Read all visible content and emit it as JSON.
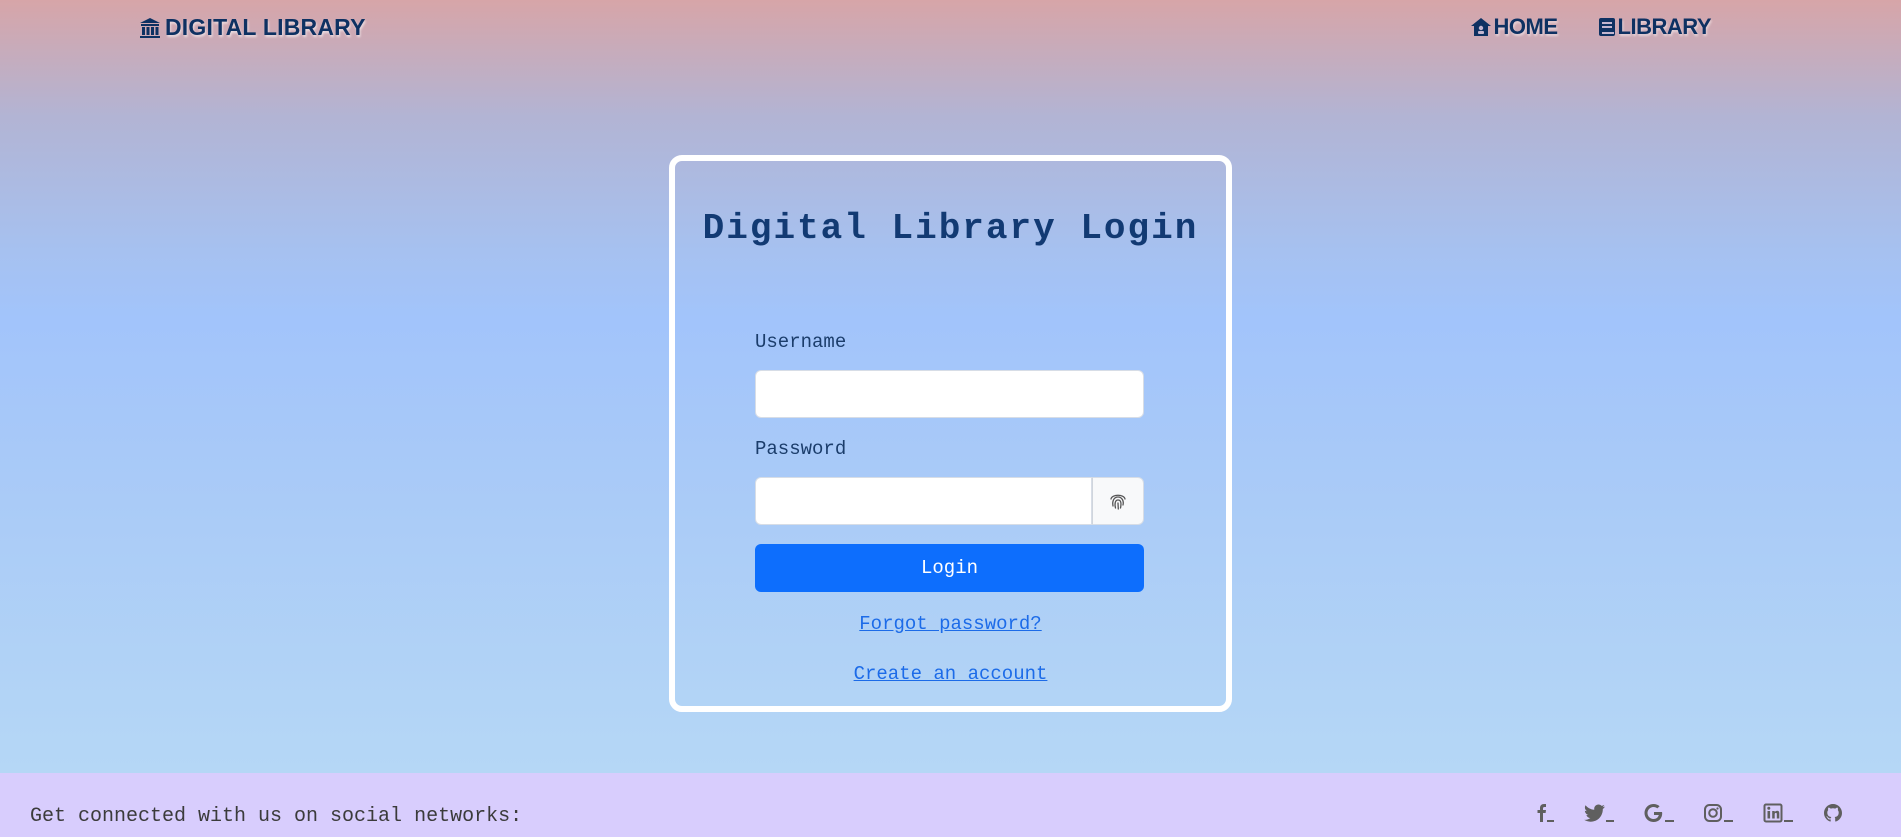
{
  "navbar": {
    "brand": "DIGITAL LIBRARY",
    "brand_icon": "bank-icon",
    "links": [
      {
        "label": "HOME",
        "icon": "house-icon"
      },
      {
        "label": "LIBRARY",
        "icon": "book-icon"
      }
    ]
  },
  "login": {
    "title": "Digital Library Login",
    "username_label": "Username",
    "username_value": "",
    "password_label": "Password",
    "password_value": "",
    "password_toggle_icon": "fingerprint-icon",
    "submit_label": "Login",
    "forgot_link": "Forgot password?",
    "create_link": "Create an account"
  },
  "footer": {
    "text": "Get connected with us on social networks:",
    "socials": [
      "facebook-icon",
      "twitter-icon",
      "google-icon",
      "instagram-icon",
      "linkedin-icon",
      "github-icon"
    ]
  },
  "colors": {
    "text_dark": "#0e3162",
    "button": "#0d6efd",
    "link": "#1c6be8",
    "footer_bg": "#d8cdfd"
  }
}
